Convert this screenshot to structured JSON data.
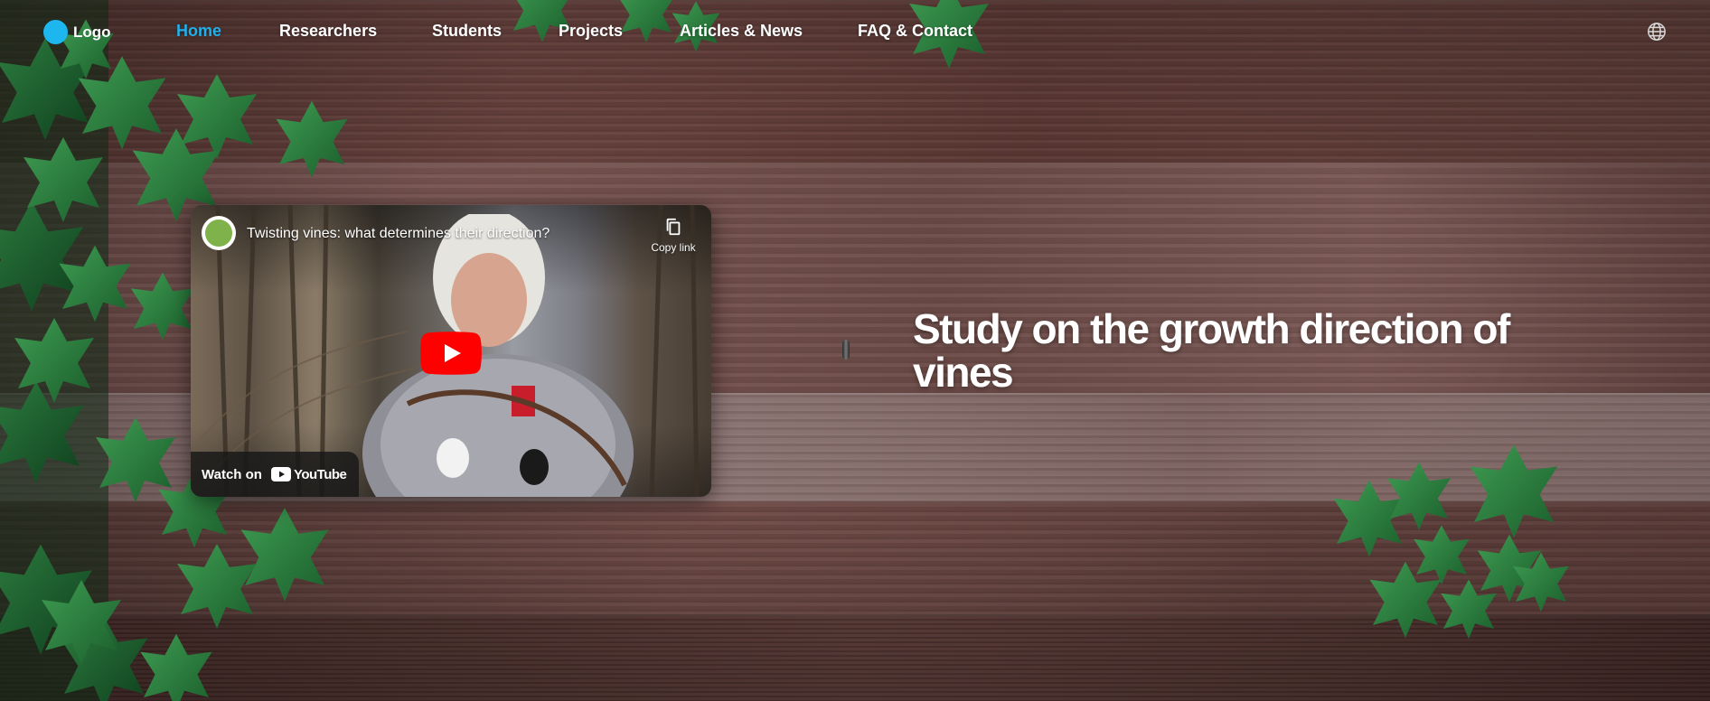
{
  "nav": {
    "logo_text": "Logo",
    "items": [
      {
        "label": "Home",
        "active": true
      },
      {
        "label": "Researchers",
        "active": false
      },
      {
        "label": "Students",
        "active": false
      },
      {
        "label": "Projects",
        "active": false
      },
      {
        "label": "Articles & News",
        "active": false
      },
      {
        "label": "FAQ & Contact",
        "active": false
      }
    ],
    "language_icon": "globe-icon"
  },
  "video": {
    "title": "Twisting vines: what determines their direction?",
    "copy_link_label": "Copy link",
    "watch_on_label": "Watch on",
    "youtube_wordmark": "YouTube",
    "play_icon": "play-icon"
  },
  "hero": {
    "heading": "Study on the growth direction of vines"
  },
  "colors": {
    "accent": "#1fb1ec",
    "logo_dot": "#1eb6ee",
    "youtube_red": "#ff0000",
    "text": "#ffffff"
  }
}
